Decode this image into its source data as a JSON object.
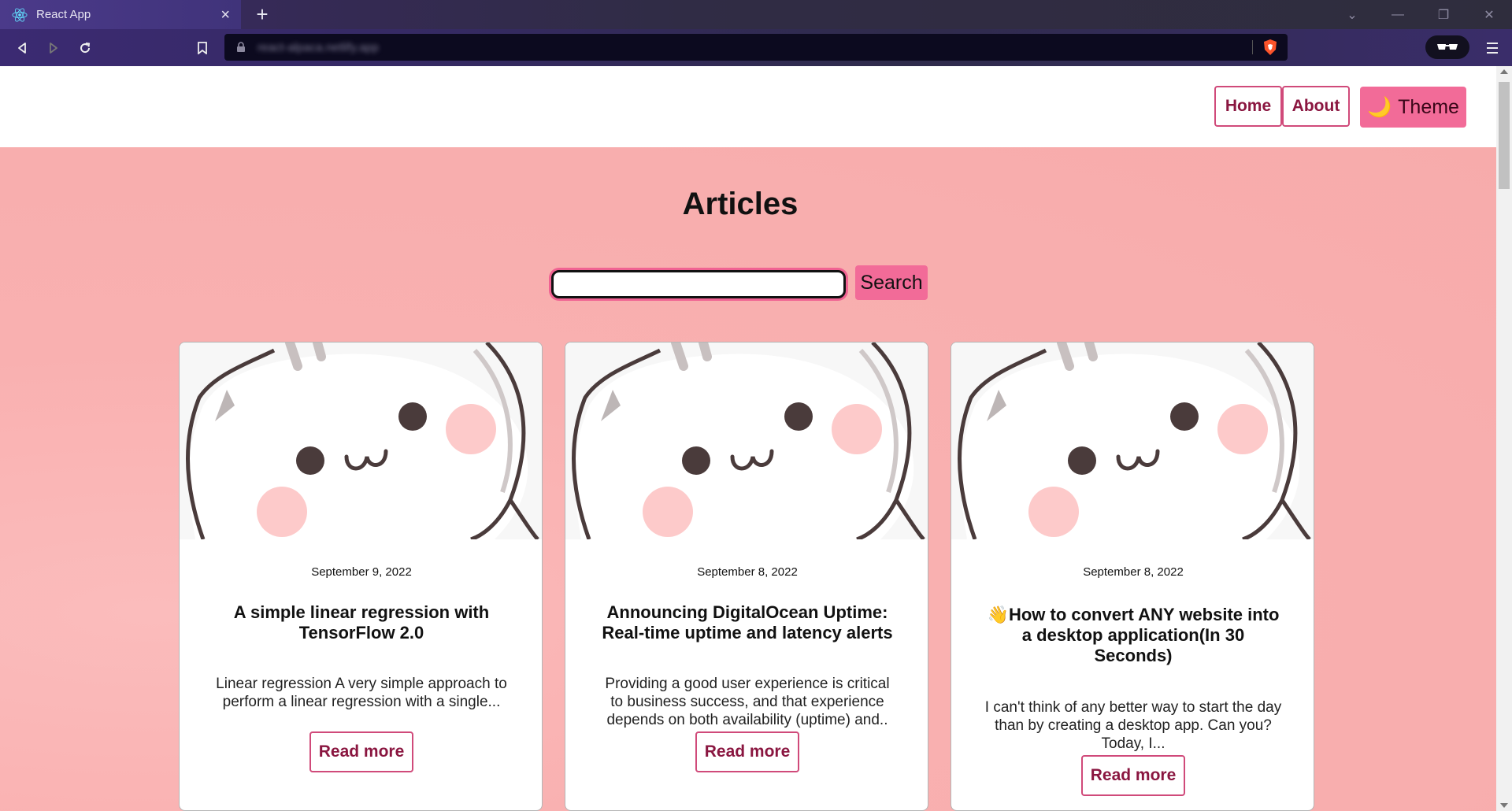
{
  "browser": {
    "tab_title": "React App",
    "tab_close": "×",
    "new_tab": "+",
    "url": "react-alpaca.netlify.app"
  },
  "header": {
    "nav": [
      "Home",
      "About"
    ],
    "theme_label": "Theme",
    "theme_icon": "🌙"
  },
  "main": {
    "title": "Articles",
    "search": {
      "value": "",
      "button_label": "Search"
    }
  },
  "articles": [
    {
      "date": "September 9, 2022",
      "title": "A simple linear regression with TensorFlow 2.0",
      "excerpt": "Linear regression A very simple approach to perform a linear regression with a single...",
      "cta": "Read more"
    },
    {
      "date": "September 8, 2022",
      "title": "Announcing DigitalOcean Uptime: Real-time uptime and latency alerts",
      "excerpt": "Providing a good user experience is critical to business success, and that experience depends on both availability (uptime) and..",
      "cta": "Read more"
    },
    {
      "date": "September 8, 2022",
      "title": "👋How to convert ANY website into a desktop application(In 30 Seconds)",
      "excerpt": "I can't think of any better way to start the day than by creating a desktop app. Can you? Today, I...",
      "cta": "Read more"
    }
  ],
  "colors": {
    "accent": "#f26b98",
    "link": "#8a1640",
    "border": "#d04a7a",
    "background": "#f8aeae"
  }
}
